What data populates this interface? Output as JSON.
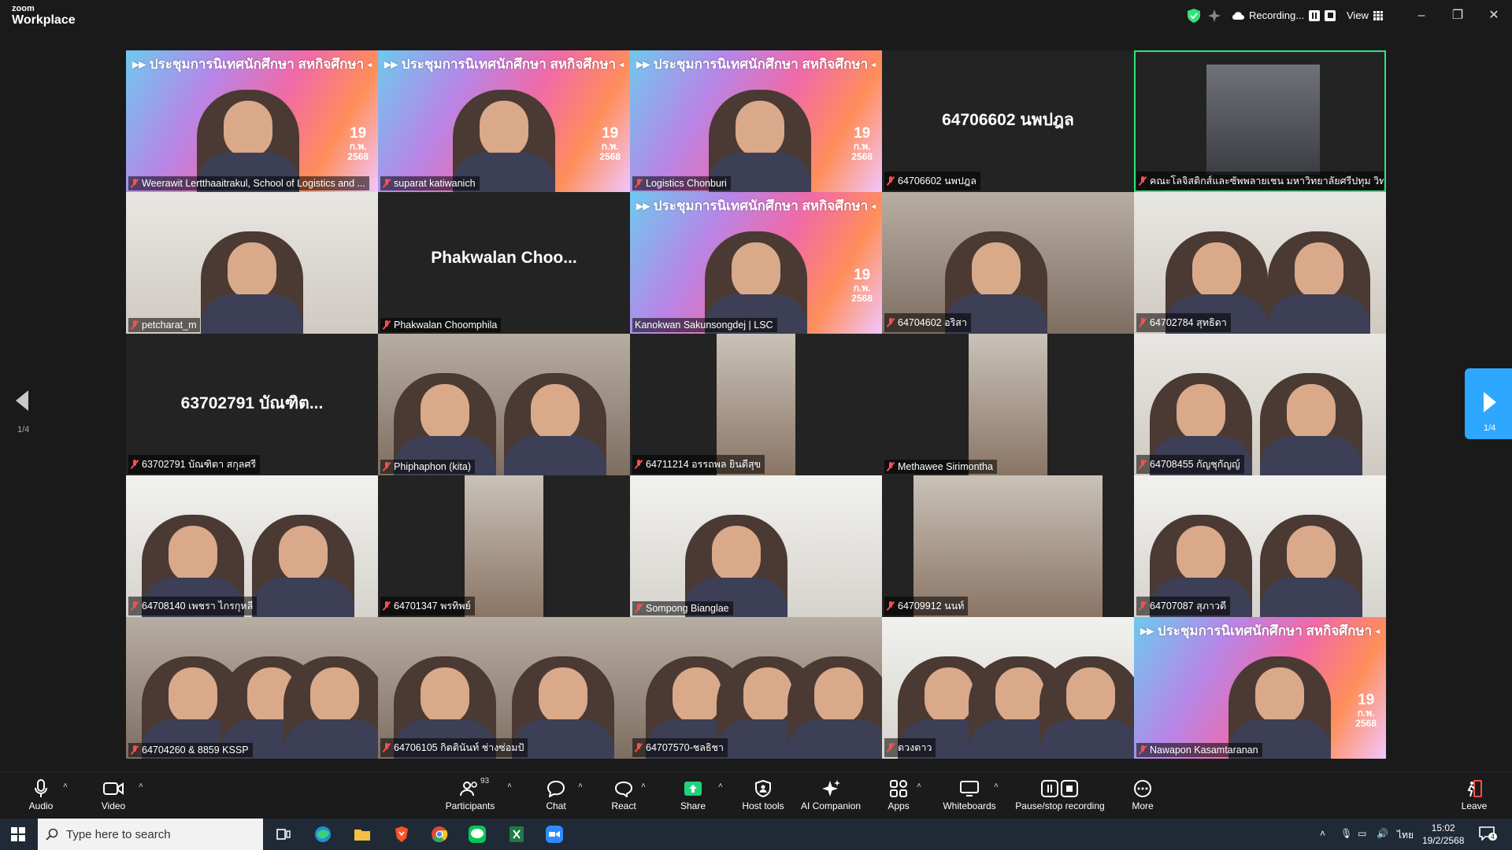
{
  "window": {
    "brand_top": "zoom",
    "brand_bottom": "Workplace",
    "recording_label": "Recording...",
    "view_label": "View"
  },
  "gallery": {
    "page_indicator_left": "1/4",
    "page_indicator_right": "1/4",
    "banner": {
      "title": "▸▸ ประชุมการนิเทศนักศึกษา สหกิจศึกษา ◂◂",
      "day": "19",
      "month": "ก.พ.",
      "year": "2568"
    },
    "tiles": [
      {
        "name": "Weerawit Lertthaaitrakul, School of Logistics and ..."
      },
      {
        "name": "suparat katiwanich"
      },
      {
        "name": "Logistics Chonburi"
      },
      {
        "name": "64706602 นพปฎล",
        "center": "64706602 นพปฎล"
      },
      {
        "name": "คณะโลจิสติกส์และซัพพลายเชน มหาวิทยาลัยศรีปทุม วิทยาเขต..."
      },
      {
        "name": "petcharat_m"
      },
      {
        "name": "Phakwalan Choomphila",
        "center": "Phakwalan Choo..."
      },
      {
        "name": "Kanokwan Sakunsongdej | LSC"
      },
      {
        "name": "64704602 อริสา"
      },
      {
        "name": "64702784 สุทธิดา"
      },
      {
        "name": "63702791 บัณฑิตา สกุลศรี",
        "center": "63702791 บัณฑิต..."
      },
      {
        "name": "Phiphaphon (kita)"
      },
      {
        "name": "64711214 อรรถพล ยินดีสุข"
      },
      {
        "name": "Methawee Sirimontha"
      },
      {
        "name": "64708455 กัญชุกัญญ์"
      },
      {
        "name": "64708140 เพชรา ไกรกุหลี"
      },
      {
        "name": "64701347 พรทิพย์"
      },
      {
        "name": "Sompong Bianglae"
      },
      {
        "name": "64709912 นนท์"
      },
      {
        "name": "64707087 สุภาวดี"
      },
      {
        "name": "64704260 & 8859 KSSP"
      },
      {
        "name": "64706105 กิตตินันท์ ช่างซ่อมปั"
      },
      {
        "name": "64707570-ชลธิชา"
      },
      {
        "name": "ดวงดาว"
      },
      {
        "name": "Nawapon Kasamtaranan"
      }
    ]
  },
  "toolbar": {
    "audio": "Audio",
    "video": "Video",
    "participants": "Participants",
    "participants_count": "93",
    "chat": "Chat",
    "react": "React",
    "share": "Share",
    "host_tools": "Host tools",
    "ai_companion": "AI Companion",
    "apps": "Apps",
    "whiteboards": "Whiteboards",
    "pause_recording": "Pause/stop recording",
    "more": "More",
    "leave": "Leave"
  },
  "taskbar": {
    "search_placeholder": "Type here to search",
    "language": "ไทย",
    "time": "15:02",
    "date": "19/2/2568",
    "notifications": "4"
  },
  "colors": {
    "share_green": "#1fd37a",
    "active_speaker": "#2ee47a",
    "page_button": "#2ea7ff",
    "muted_red": "#ff4d4d",
    "leave_red": "#ff4d4d"
  }
}
